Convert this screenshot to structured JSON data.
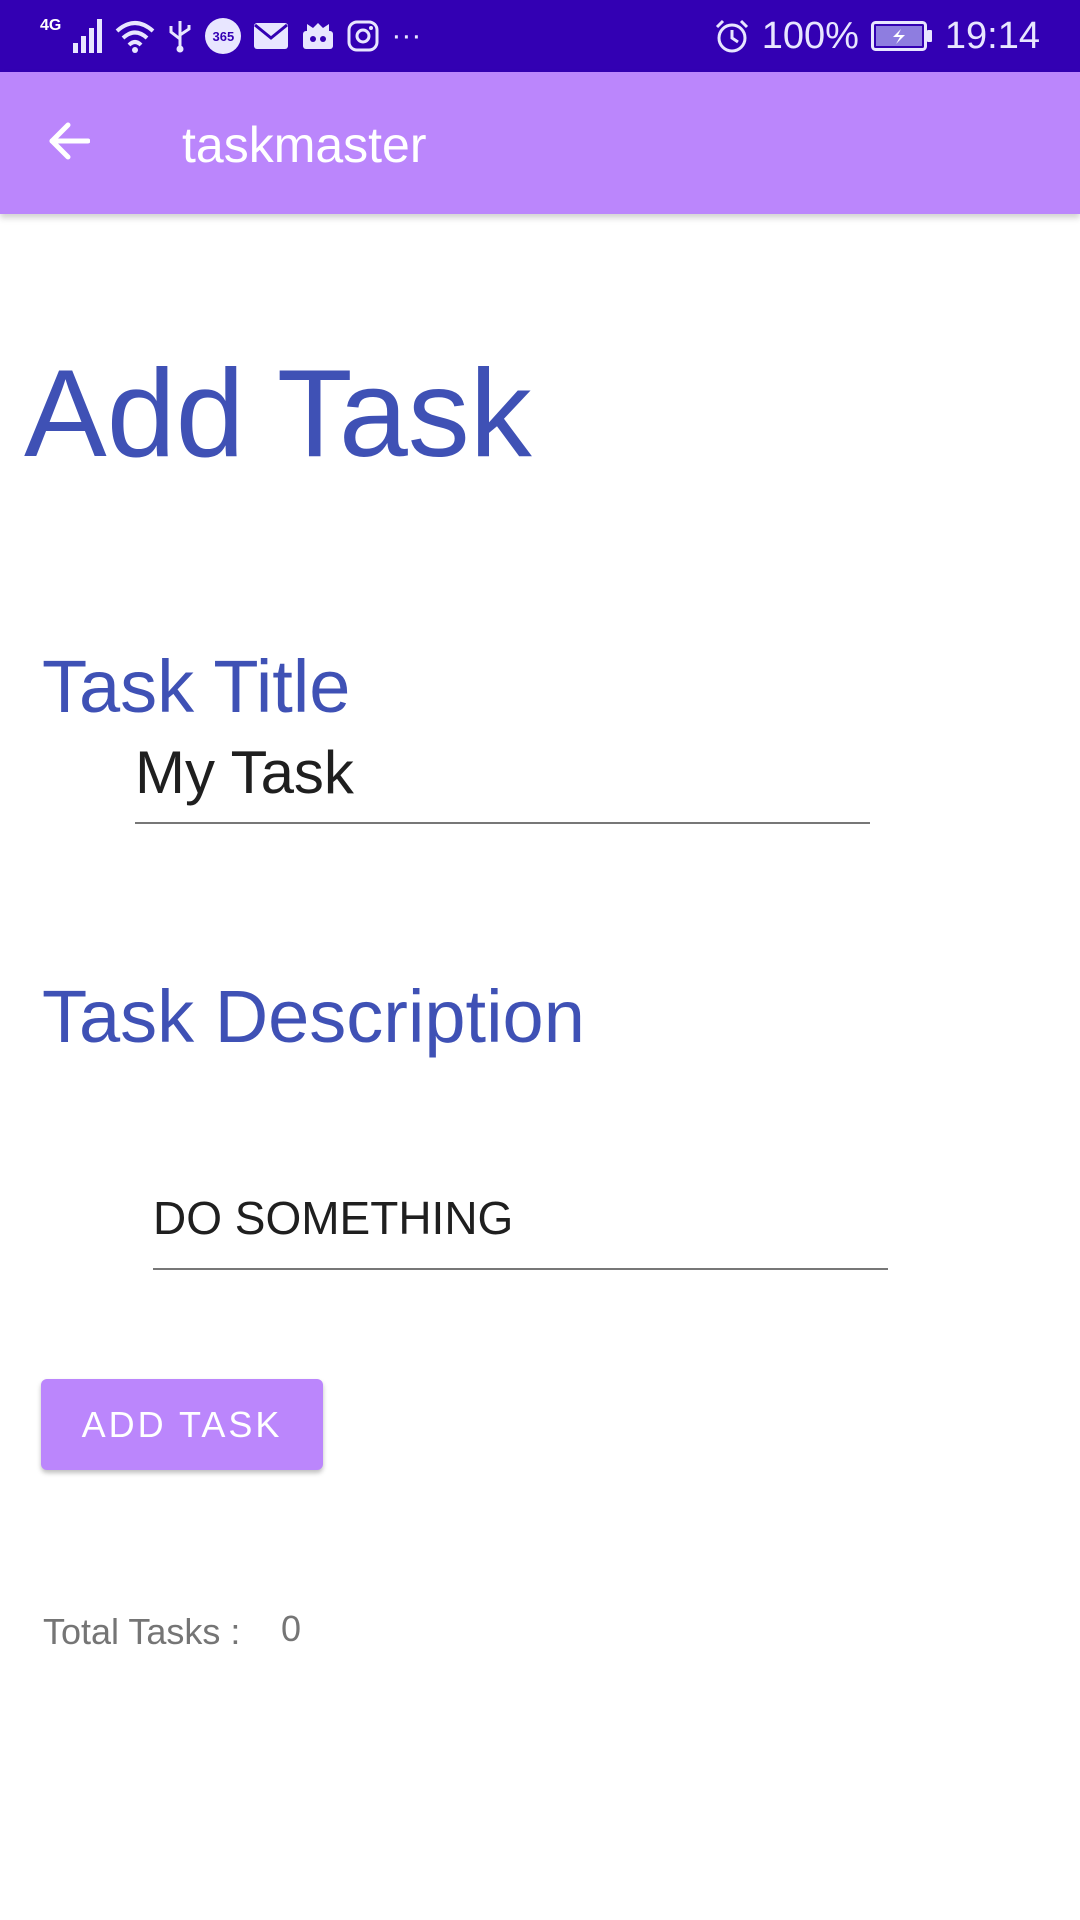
{
  "status_bar": {
    "network_type": "4G",
    "icons": [
      "signal-icon",
      "wifi-icon",
      "usb-icon",
      "office365-icon",
      "mail-icon",
      "app-icon",
      "instagram-icon",
      "more-notifications-icon",
      "alarm-icon",
      "battery-charging-icon"
    ],
    "app_badge": "365",
    "more": "···",
    "battery_percent": "100%",
    "time": "19:14"
  },
  "app_bar": {
    "back_icon": "arrow-back-icon",
    "title": "taskmaster"
  },
  "page": {
    "heading": "Add Task",
    "task_title_label": "Task Title",
    "task_title_value": "My Task",
    "task_description_label": "Task Description",
    "task_description_value": "DO SOMETHING",
    "add_button_label": "ADD TASK",
    "total_tasks_label": "Total Tasks :",
    "total_tasks_count": "0"
  },
  "colors": {
    "status_bar": "#3300b3",
    "app_bar": "#bb86fc",
    "heading_text": "#3f51b5",
    "button": "#bb86fc",
    "muted_text": "#757575"
  }
}
